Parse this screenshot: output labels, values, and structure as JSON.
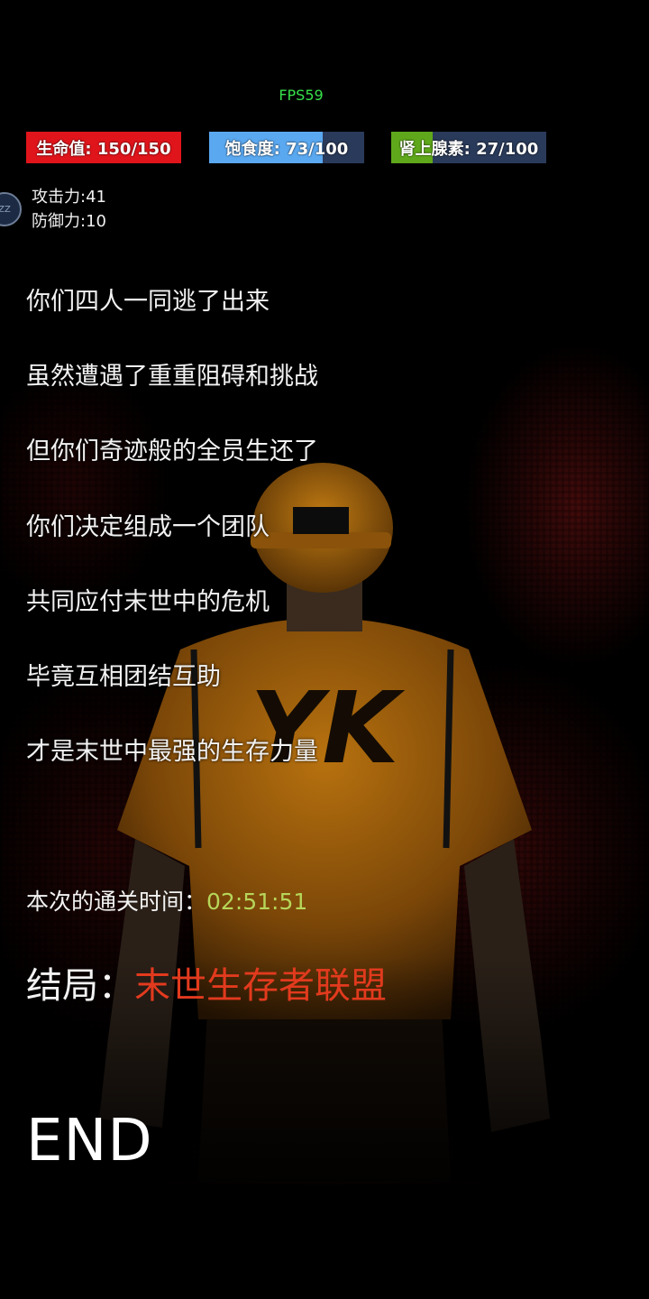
{
  "hud": {
    "fps": "FPS59",
    "stats": {
      "hp": {
        "label": "生命值: 150/150",
        "value": 150,
        "max": 150,
        "color": "#e0151b"
      },
      "hunger": {
        "label": "饱食度: 73/100",
        "value": 73,
        "max": 100,
        "color": "#5aa8f0"
      },
      "adrenaline": {
        "label": "肾上腺素: 27/100",
        "value": 27,
        "max": 100,
        "color": "#5fa81b"
      }
    },
    "attack": "攻击力:41",
    "defense": "防御力:10",
    "sleep_button": "ZZ"
  },
  "story": {
    "lines": [
      "你们四人一同逃了出来",
      "虽然遭遇了重重阻碍和挑战",
      "但你们奇迹般的全员生还了",
      "你们决定组成一个团队",
      "共同应付末世中的危机",
      "毕竟互相团结互助",
      "才是末世中最强的生存力量"
    ]
  },
  "result": {
    "time_label": "本次的通关时间：",
    "time_value": "02:51:51",
    "ending_label": "结局：",
    "ending_name": "末世生存者联盟",
    "end": "END"
  }
}
